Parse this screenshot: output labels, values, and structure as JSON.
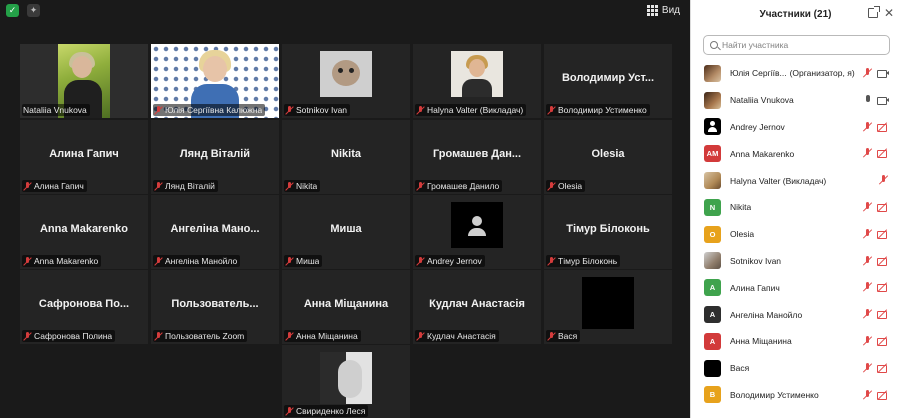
{
  "header": {
    "view_label": "Вид"
  },
  "tiles": {
    "natalia": {
      "label": "Nataliia Vnukova"
    },
    "yulia": {
      "label": "Юлія Сергіївна Калюжна"
    },
    "sotnikov": {
      "label": "Sotnikov Ivan"
    },
    "halyna": {
      "label": "Halyna Valter (Викладач)"
    },
    "volodymyr": {
      "big": "Володимир Уст...",
      "label": "Володимир Устименко"
    },
    "alina": {
      "big": "Алина Гапич",
      "label": "Алина Гапич"
    },
    "liand": {
      "big": "Лянд Віталій",
      "label": "Лянд Віталій"
    },
    "nikita": {
      "big": "Nikita",
      "label": "Nikita"
    },
    "gromashev": {
      "big": "Громашев Дан...",
      "label": "Громашев Данило"
    },
    "olesia": {
      "big": "Olesia",
      "label": "Olesia"
    },
    "anna_m": {
      "big": "Anna Makarenko",
      "label": "Anna Makarenko"
    },
    "anhelina": {
      "big": "Ангеліна Мано...",
      "label": "Ангеліна Манойло"
    },
    "misha": {
      "big": "Миша",
      "label": "Миша"
    },
    "andrey": {
      "label": "Andrey Jernov"
    },
    "timur": {
      "big": "Тімур Білоконь",
      "label": "Тімур Білоконь"
    },
    "safronova": {
      "big": "Сафронова По...",
      "label": "Сафронова Полина"
    },
    "polzovatel": {
      "big": "Пользователь...",
      "label": "Пользователь Zoom"
    },
    "anna_mish": {
      "big": "Анна Міщанина",
      "label": "Анна Міщанина"
    },
    "kudlach": {
      "big": "Кудлач Анастасія",
      "label": "Кудлач Анастасія"
    },
    "vasya": {
      "label": "Вася"
    },
    "svyrydenko": {
      "label": "Свириденко Леся"
    }
  },
  "panel": {
    "title": "Участники (21)",
    "search_placeholder": "Найти участника",
    "participants": [
      {
        "name": "Юлія Сергіїв...",
        "role": "(Организатор, я)",
        "avatar": "photo",
        "mic": "off",
        "cam": "on"
      },
      {
        "name": "Nataliia Vnukova",
        "role": "",
        "avatar": "photo",
        "mic": "on",
        "cam": "on"
      },
      {
        "name": "Andrey Jernov",
        "role": "",
        "avatar": "user-icon",
        "mic": "off",
        "cam": "off"
      },
      {
        "name": "Anna Makarenko",
        "role": "",
        "initials": "AM",
        "color": "#d23a3a",
        "mic": "off",
        "cam": "off"
      },
      {
        "name": "Halyna Valter (Викладач)",
        "role": "",
        "avatar": "photo",
        "mic": "off",
        "cam": "none"
      },
      {
        "name": "Nikita",
        "role": "",
        "initials": "N",
        "color": "#3fa34d",
        "mic": "off",
        "cam": "off"
      },
      {
        "name": "Olesia",
        "role": "",
        "initials": "O",
        "color": "#e7a21c",
        "mic": "off",
        "cam": "off"
      },
      {
        "name": "Sotnikov Ivan",
        "role": "",
        "avatar": "photo",
        "mic": "off",
        "cam": "off"
      },
      {
        "name": "Алина Гапич",
        "role": "",
        "initials": "А",
        "color": "#3fa34d",
        "mic": "off",
        "cam": "off"
      },
      {
        "name": "Ангеліна Манойло",
        "role": "",
        "initials": "А",
        "color": "#2e2e2e",
        "mic": "off",
        "cam": "off"
      },
      {
        "name": "Анна Міщанина",
        "role": "",
        "initials": "А",
        "color": "#d23a3a",
        "mic": "off",
        "cam": "off"
      },
      {
        "name": "Вася",
        "role": "",
        "initials": "",
        "color": "#000000",
        "mic": "off",
        "cam": "off"
      },
      {
        "name": "Володимир Устименко",
        "role": "",
        "initials": "В",
        "color": "#e7a21c",
        "mic": "off",
        "cam": "off"
      }
    ]
  },
  "colors": {
    "active_speaker": "#e6d15a",
    "muted": "#e04848",
    "host_shield": "#24a148"
  }
}
